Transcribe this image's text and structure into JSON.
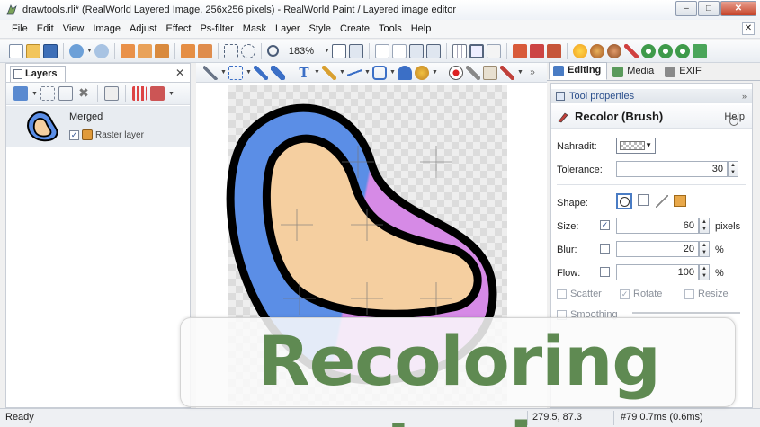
{
  "window": {
    "title": "drawtools.rli* (RealWorld Layered Image, 256x256 pixels) - RealWorld Paint / Layered image editor",
    "minimize": "–",
    "maximize": "□",
    "close": "✕"
  },
  "menu": [
    "File",
    "Edit",
    "View",
    "Image",
    "Adjust",
    "Effect",
    "Ps-filter",
    "Mask",
    "Layer",
    "Style",
    "Create",
    "Tools",
    "Help"
  ],
  "mdi_close": "✕",
  "toolbar": {
    "zoom": "183%"
  },
  "layers_panel": {
    "tab": "Layers",
    "close": "✕",
    "layers": [
      {
        "name": "Merged",
        "sublayer": "Raster layer",
        "checked": "✓"
      }
    ]
  },
  "right_tabs": [
    "Editing",
    "Media",
    "EXIF"
  ],
  "tool_properties": {
    "header": "Tool properties",
    "collapse": "»",
    "tool_name": "Recolor (Brush)",
    "help": "Help",
    "replace_label": "Nahradit:",
    "tolerance_label": "Tolerance:",
    "tolerance_value": "30",
    "shape_label": "Shape:",
    "size_label": "Size:",
    "size_value": "60",
    "size_unit": "pixels",
    "size_checked": "✓",
    "blur_label": "Blur:",
    "blur_value": "20",
    "blur_unit": "%",
    "flow_label": "Flow:",
    "flow_value": "100",
    "flow_unit": "%",
    "scatter_label": "Scatter",
    "rotate_label": "Rotate",
    "rotate_checked": "✓",
    "resize_label": "Resize",
    "smoothing_label": "Smoothing"
  },
  "status": {
    "text": "Ready",
    "coords": "279.5, 87.3",
    "perf": "#79 0.7ms (0.6ms)"
  },
  "banner": {
    "text": "Recoloring tool"
  },
  "colors": {
    "bean_fill": "#f5cfa0",
    "bean_outer_blue": "#5b8ee6",
    "bean_outer_purple": "#d68ae6",
    "banner_text": "#5f8a52",
    "header_text": "#2b4f8c"
  }
}
